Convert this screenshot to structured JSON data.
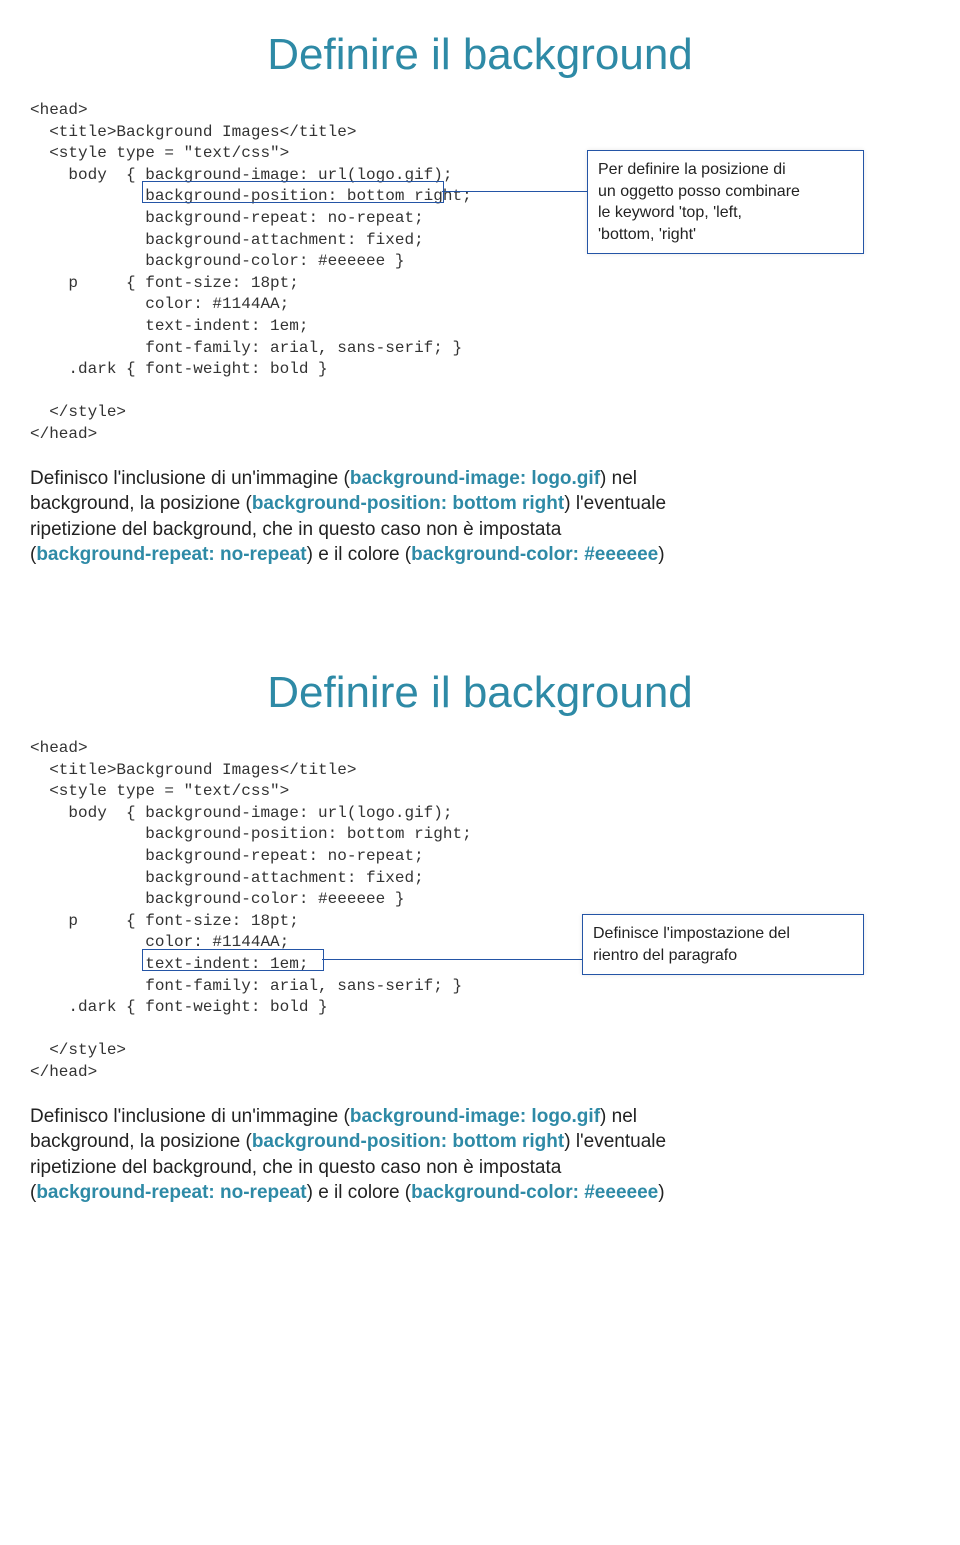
{
  "slide1": {
    "title": "Definire il background",
    "code": "<head>\n  <title>Background Images</title>\n  <style type = \"text/css\">\n    body  { background-image: url(logo.gif);\n            background-position: bottom right;\n            background-repeat: no-repeat;\n            background-attachment: fixed;\n            background-color: #eeeeee }\n    p     { font-size: 18pt;\n            color: #1144AA;\n            text-indent: 1em;\n            font-family: arial, sans-serif; }\n    .dark { font-weight: bold }\n\n  </style>\n</head>",
    "callout": "Per definire la posizione di\nun oggetto posso combinare\nle keyword 'top, 'left,\n'bottom, 'right'",
    "desc_pre": "Definisco l'inclusione di un'immagine (",
    "kw1": "background-image: logo.gif",
    "desc_mid1": ") nel\nbackground, la posizione (",
    "kw2": "background-position: bottom right",
    "desc_mid2": ") l'eventuale\nripetizione del background, che in questo caso non è impostata\n(",
    "kw3": "background-repeat: no-repeat",
    "desc_mid3": ") e il colore (",
    "kw4": "background-color: #eeeeee",
    "desc_end": ")"
  },
  "slide2": {
    "title": "Definire il background",
    "code": "<head>\n  <title>Background Images</title>\n  <style type = \"text/css\">\n    body  { background-image: url(logo.gif);\n            background-position: bottom right;\n            background-repeat: no-repeat;\n            background-attachment: fixed;\n            background-color: #eeeeee }\n    p     { font-size: 18pt;\n            color: #1144AA;\n            text-indent: 1em;\n            font-family: arial, sans-serif; }\n    .dark { font-weight: bold }\n\n  </style>\n</head>",
    "callout": "Definisce l'impostazione del\nrientro del paragrafo",
    "desc_pre": "Definisco l'inclusione di un'immagine (",
    "kw1": "background-image: logo.gif",
    "desc_mid1": ") nel\nbackground, la posizione (",
    "kw2": "background-position: bottom right",
    "desc_mid2": ") l'eventuale\nripetizione del background, che in questo caso non è impostata\n(",
    "kw3": "background-repeat: no-repeat",
    "desc_mid3": ") e il colore (",
    "kw4": "background-color: #eeeeee",
    "desc_end": ")"
  }
}
